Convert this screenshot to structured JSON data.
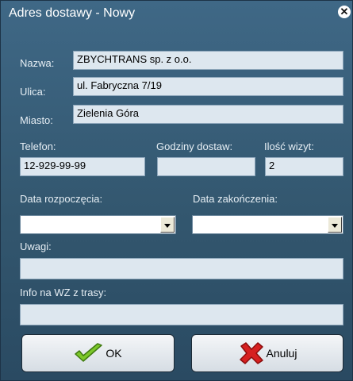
{
  "window": {
    "title": "Adres dostawy - Nowy"
  },
  "form": {
    "nazwa": {
      "label": "Nazwa:",
      "value": "ZBYCHTRANS sp. z o.o."
    },
    "ulica": {
      "label": "Ulica:",
      "value": "ul. Fabryczna 7/19"
    },
    "miasto": {
      "label": "Miasto:",
      "value": "Zielenia Góra"
    },
    "telefon": {
      "label": "Telefon:",
      "value": "12-929-99-99"
    },
    "godziny": {
      "label": "Godziny  dostaw:",
      "value": ""
    },
    "ilosc": {
      "label": "Ilość wizyt:",
      "value": "2"
    },
    "data_rozpoczecia": {
      "label": "Data rozpoczęcia:",
      "value": ""
    },
    "data_zakonczenia": {
      "label": "Data zakończenia:",
      "value": ""
    },
    "uwagi": {
      "label": "Uwagi:",
      "value": ""
    },
    "info_wz": {
      "label": "Info na WZ z trasy:",
      "value": ""
    }
  },
  "buttons": {
    "ok": "OK",
    "cancel": "Anuluj"
  },
  "icons": {
    "close": "close-icon",
    "ok": "checkmark-icon",
    "cancel": "red-x-icon"
  },
  "colors": {
    "window_bg": "#3f6886",
    "field_bg": "#dde7ef",
    "ok_icon": "#7cc72a",
    "cancel_icon": "#d62020"
  }
}
